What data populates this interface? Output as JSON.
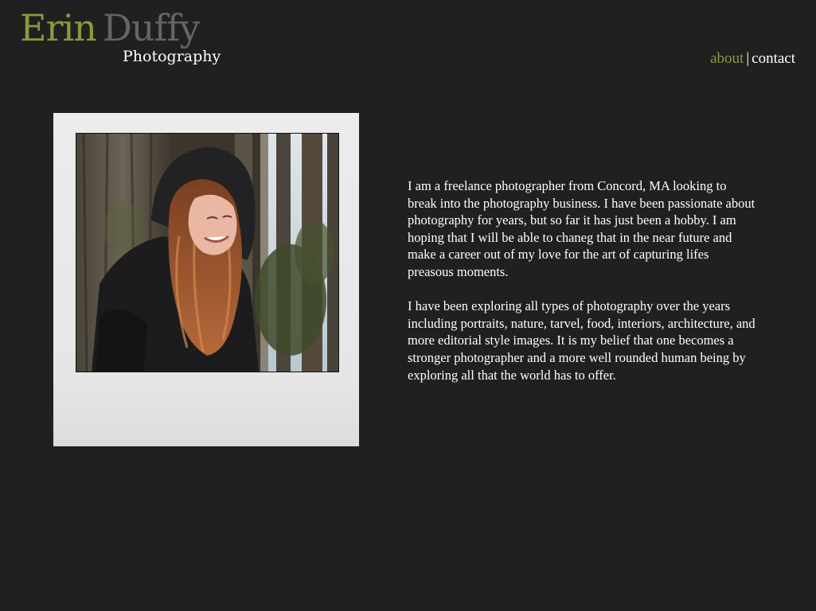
{
  "header": {
    "logo": {
      "first_name": "Erin",
      "last_name": "Duffy",
      "subtitle": "Photography"
    },
    "nav": {
      "about_label": "about",
      "separator": "|",
      "contact_label": "contact"
    }
  },
  "main": {
    "photo": {
      "alt": "Portrait of a smiling woman with long red hair wearing a black hooded jacket in front of trees"
    },
    "about_paragraphs": [
      "I am a  freelance photographer from Concord, MA looking to break into the photography business. I have been passionate about photography for years, but so far it has just been a hobby. I am hoping that I will be able to chaneg that in the near future and make a career out of my love for the art of capturing lifes preasous moments.",
      "I have been exploring all types of photography over the years including  portraits, nature, tarvel, food, interiors, architecture, and more editorial style images. It is my belief that one becomes a stronger photographer and a more well rounded human being by exploring all that the world has to offer."
    ]
  },
  "colors": {
    "background": "#221f20",
    "accent_green": "#8a9a3e",
    "logo_gray": "#656565",
    "text": "#ffffff",
    "polaroid_frame": "#ececec"
  }
}
